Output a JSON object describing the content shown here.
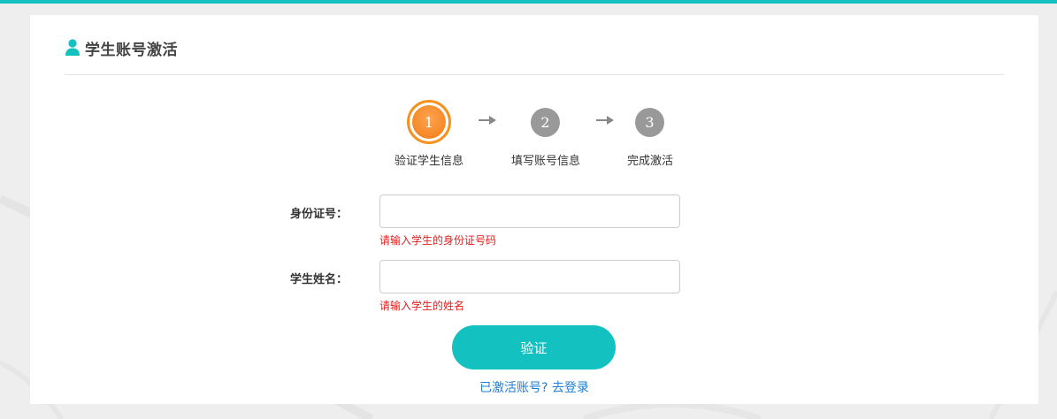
{
  "header": {
    "title": "学生账号激活",
    "icon": "user-icon"
  },
  "steps": [
    {
      "number": "1",
      "label": "验证学生信息",
      "state": "active"
    },
    {
      "number": "2",
      "label": "填写账号信息",
      "state": "pending"
    },
    {
      "number": "3",
      "label": "完成激活",
      "state": "pending"
    }
  ],
  "form": {
    "id_number": {
      "label": "身份证号：",
      "value": "",
      "placeholder": "",
      "hint": "请输入学生的身份证号码"
    },
    "student_name": {
      "label": "学生姓名：",
      "value": "",
      "placeholder": "",
      "hint": "请输入学生的姓名"
    },
    "verify_button": "验证",
    "login_link": "已激活账号? 去登录"
  },
  "colors": {
    "accent": "#12c1c0",
    "active_step": "#f47a12",
    "pending_step": "#999999",
    "error": "#e02020",
    "link": "#1e7ed6"
  }
}
